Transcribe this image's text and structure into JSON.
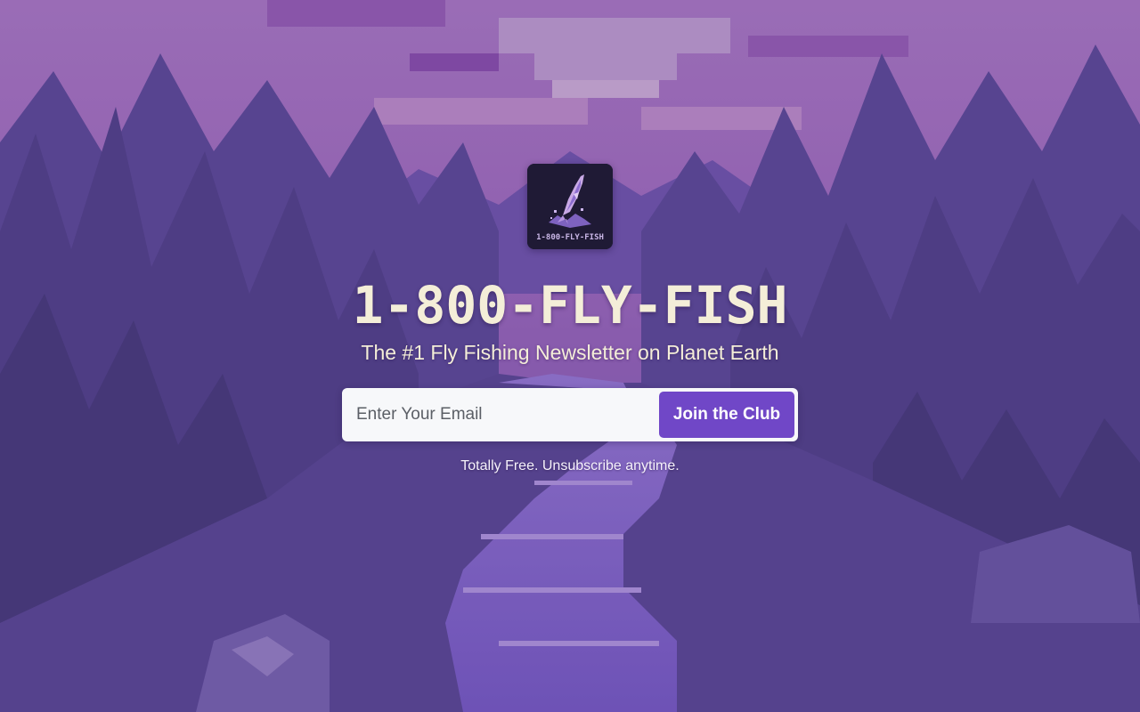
{
  "brand": {
    "logo_text": "1-800-FLY-FISH",
    "title": "1-800-FLY-FISH",
    "subtitle": "The #1 Fly Fishing Newsletter on Planet Earth"
  },
  "signup": {
    "email_placeholder": "Enter Your Email",
    "email_value": "",
    "button_label": "Join the Club",
    "fineprint": "Totally Free. Unsubscribe anytime."
  },
  "colors": {
    "accent": "#7047c7",
    "title_text": "#f4eed8",
    "background": "#4a3d78",
    "logo_bg": "#1f1a35"
  },
  "icons": {
    "background": "pixel-art-forest-river-illustration",
    "logo": "leaping-fish-logo"
  }
}
